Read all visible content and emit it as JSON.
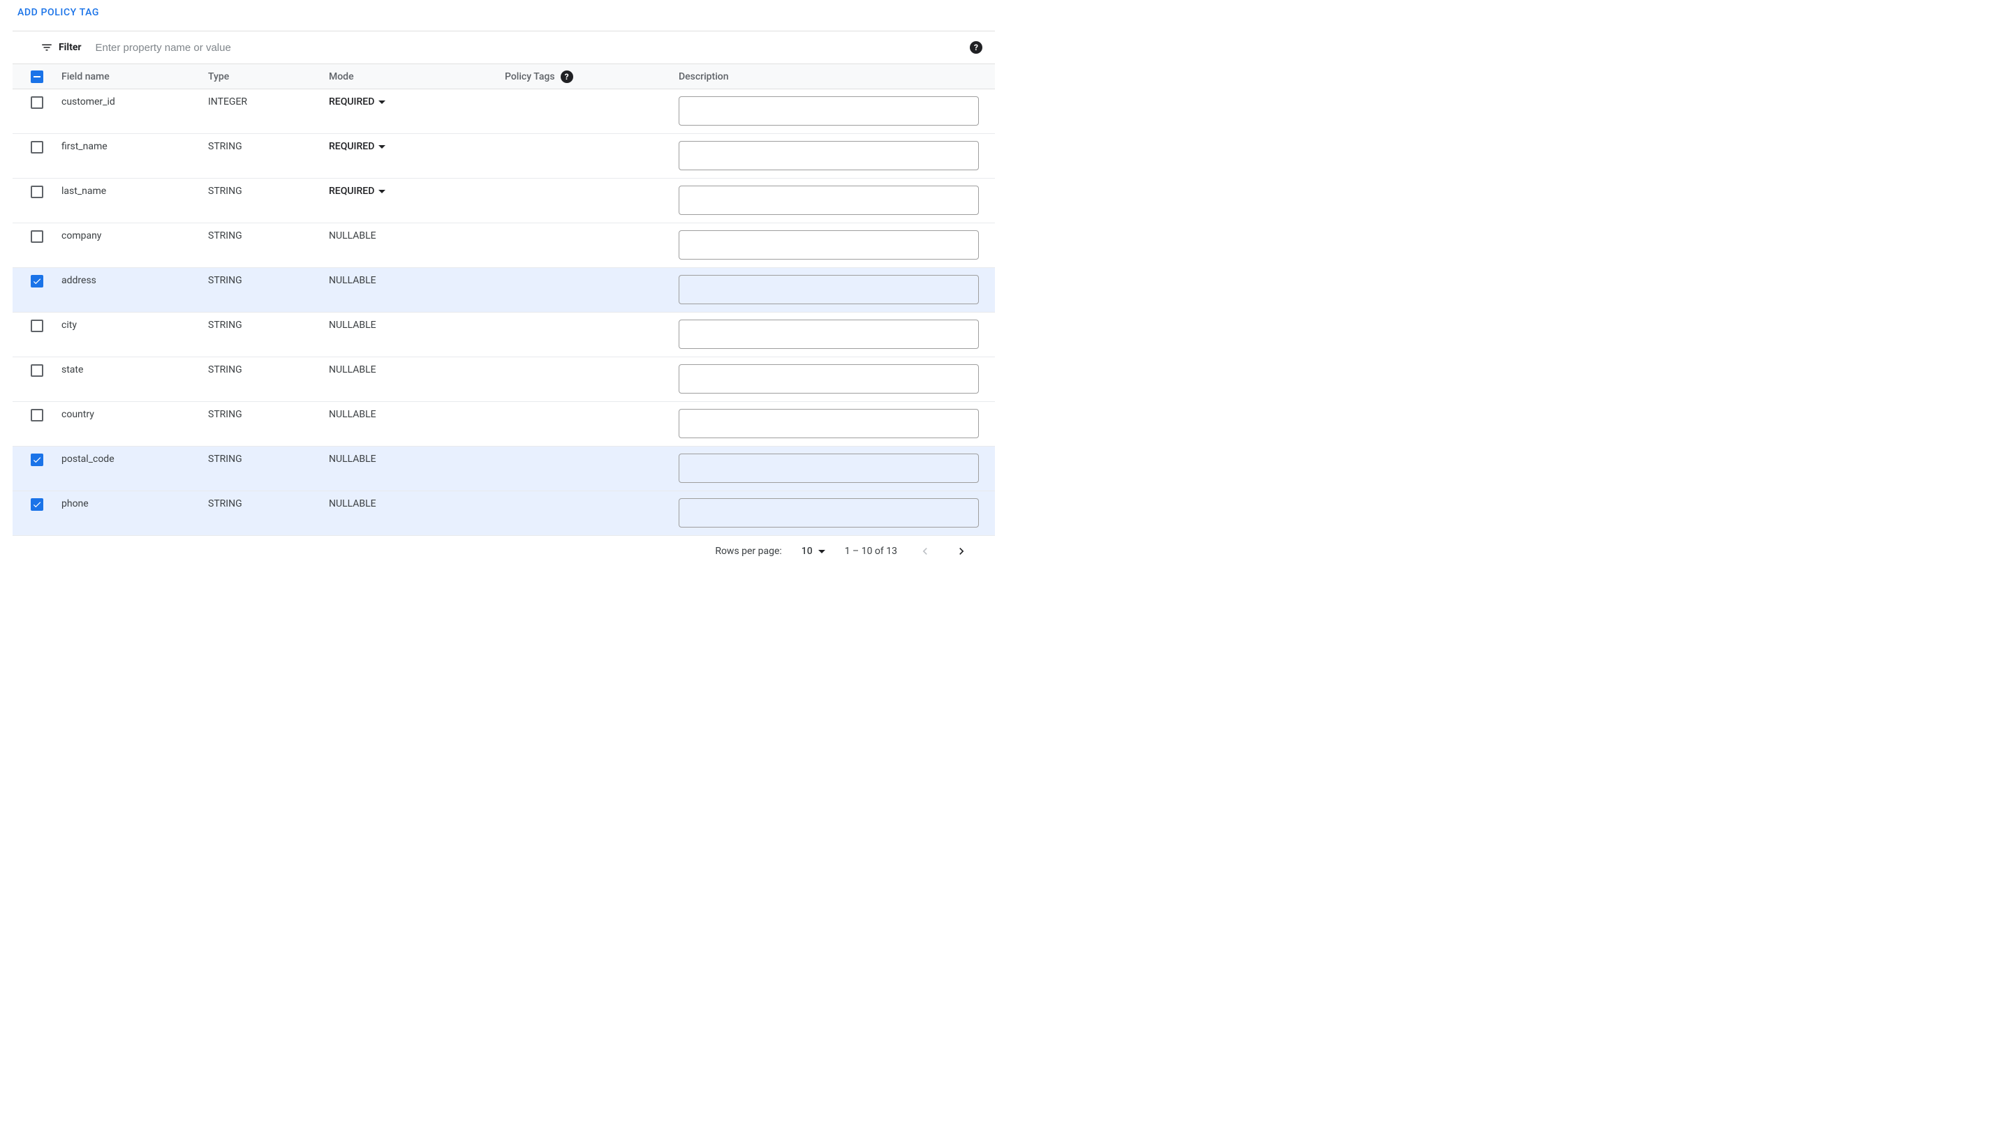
{
  "actions": {
    "add_policy_tag": "ADD POLICY TAG"
  },
  "filter": {
    "label": "Filter",
    "placeholder": "Enter property name or value"
  },
  "columns": {
    "field_name": "Field name",
    "type": "Type",
    "mode": "Mode",
    "policy_tags": "Policy Tags",
    "description": "Description"
  },
  "rows": [
    {
      "name": "customer_id",
      "type": "INTEGER",
      "mode": "REQUIRED",
      "mode_editable": true,
      "selected": false,
      "description": ""
    },
    {
      "name": "first_name",
      "type": "STRING",
      "mode": "REQUIRED",
      "mode_editable": true,
      "selected": false,
      "description": ""
    },
    {
      "name": "last_name",
      "type": "STRING",
      "mode": "REQUIRED",
      "mode_editable": true,
      "selected": false,
      "description": ""
    },
    {
      "name": "company",
      "type": "STRING",
      "mode": "NULLABLE",
      "mode_editable": false,
      "selected": false,
      "description": ""
    },
    {
      "name": "address",
      "type": "STRING",
      "mode": "NULLABLE",
      "mode_editable": false,
      "selected": true,
      "description": ""
    },
    {
      "name": "city",
      "type": "STRING",
      "mode": "NULLABLE",
      "mode_editable": false,
      "selected": false,
      "description": ""
    },
    {
      "name": "state",
      "type": "STRING",
      "mode": "NULLABLE",
      "mode_editable": false,
      "selected": false,
      "description": ""
    },
    {
      "name": "country",
      "type": "STRING",
      "mode": "NULLABLE",
      "mode_editable": false,
      "selected": false,
      "description": ""
    },
    {
      "name": "postal_code",
      "type": "STRING",
      "mode": "NULLABLE",
      "mode_editable": false,
      "selected": true,
      "description": ""
    },
    {
      "name": "phone",
      "type": "STRING",
      "mode": "NULLABLE",
      "mode_editable": false,
      "selected": true,
      "description": ""
    }
  ],
  "pagination": {
    "rows_per_page_label": "Rows per page:",
    "rows_per_page_value": "10",
    "range_text": "1 – 10 of 13"
  }
}
